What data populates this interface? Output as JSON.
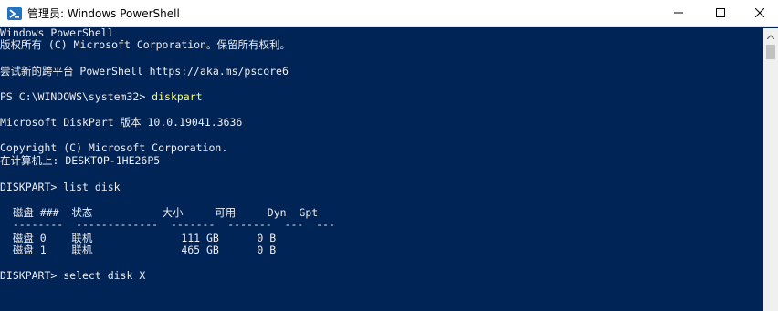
{
  "window": {
    "title": "管理员: Windows PowerShell",
    "icon": "powershell-icon",
    "controls": [
      "minimize-icon",
      "maximize-icon",
      "close-icon"
    ]
  },
  "console": {
    "lines": {
      "l1": "Windows PowerShell",
      "l2": "版权所有 (C) Microsoft Corporation。保留所有权利。",
      "l3": "尝试新的跨平台 PowerShell https://aka.ms/pscore6",
      "l4_prompt": "PS C:\\WINDOWS\\system32> ",
      "l4_cmd": "diskpart",
      "l5": "Microsoft DiskPart 版本 10.0.19041.3636",
      "l6": "Copyright (C) Microsoft Corporation.",
      "l7": "在计算机上: DESKTOP-1HE26P5",
      "l8": "DISKPART> list disk",
      "l9": "  磁盘 ###  状态           大小     可用     Dyn  Gpt",
      "l10": "  --------  -------------  -------  -------  ---  ---",
      "l11": "  磁盘 0    联机              111 GB      0 B",
      "l12": "  磁盘 1    联机              465 GB      0 B",
      "l13": "DISKPART> select disk X"
    }
  },
  "colors": {
    "background": "#012456",
    "text": "#eeedf0",
    "command": "#ffff66"
  }
}
